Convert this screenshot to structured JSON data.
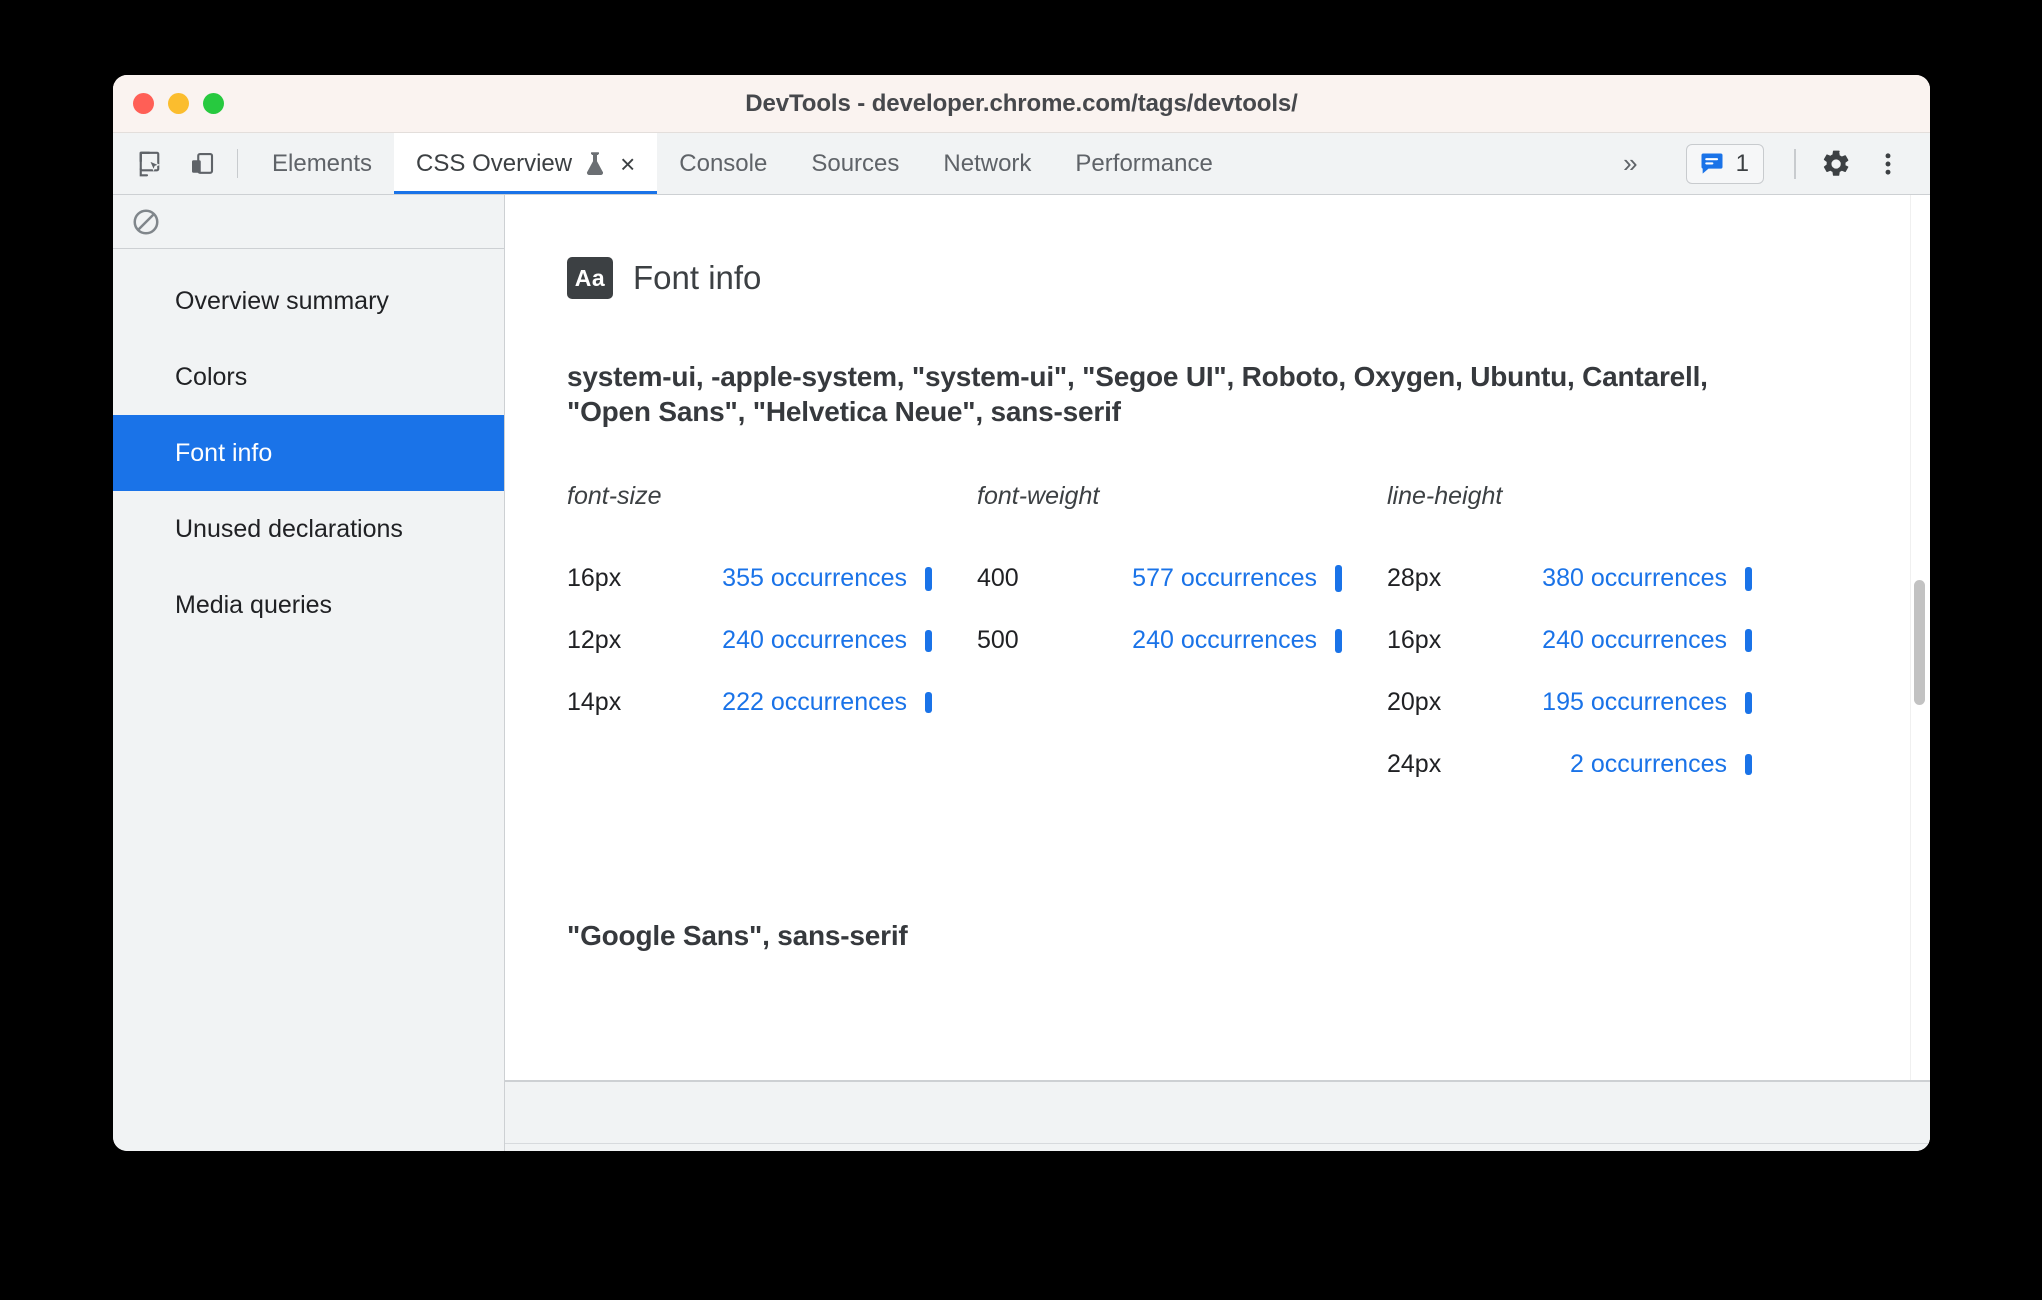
{
  "window": {
    "title": "DevTools - developer.chrome.com/tags/devtools/",
    "traffic_lights": [
      "close",
      "minimize",
      "maximize"
    ]
  },
  "toolbar": {
    "inspect_icon": "inspect-cursor-icon",
    "device_icon": "device-toolbar-icon",
    "tabs": [
      {
        "label": "Elements",
        "active": false
      },
      {
        "label": "CSS Overview",
        "active": true,
        "experimental": true,
        "closable": true,
        "close_label": "×"
      },
      {
        "label": "Console",
        "active": false
      },
      {
        "label": "Sources",
        "active": false
      },
      {
        "label": "Network",
        "active": false
      },
      {
        "label": "Performance",
        "active": false
      }
    ],
    "overflow_label": "»",
    "issues_count": "1",
    "issues_icon": "message-bubble-icon",
    "settings_icon": "gear-icon",
    "more_icon": "kebab-menu-icon"
  },
  "sidebar": {
    "clear_icon": "no-entry-icon",
    "items": [
      {
        "label": "Overview summary",
        "selected": false
      },
      {
        "label": "Colors",
        "selected": false
      },
      {
        "label": "Font info",
        "selected": true
      },
      {
        "label": "Unused declarations",
        "selected": false
      },
      {
        "label": "Media queries",
        "selected": false
      }
    ]
  },
  "main": {
    "badge_text": "Aa",
    "panel_title": "Font info",
    "font_families": [
      {
        "name": "system-ui, -apple-system, \"system-ui\", \"Segoe UI\", Roboto, Oxygen, Ubuntu, Cantarell, \"Open Sans\", \"Helvetica Neue\", sans-serif",
        "columns": [
          {
            "header": "font-size",
            "rows": [
              {
                "value": "16px",
                "occurrences": "355 occurrences",
                "count": 355
              },
              {
                "value": "12px",
                "occurrences": "240 occurrences",
                "count": 240
              },
              {
                "value": "14px",
                "occurrences": "222 occurrences",
                "count": 222
              }
            ]
          },
          {
            "header": "font-weight",
            "rows": [
              {
                "value": "400",
                "occurrences": "577 occurrences",
                "count": 577
              },
              {
                "value": "500",
                "occurrences": "240 occurrences",
                "count": 240
              }
            ]
          },
          {
            "header": "line-height",
            "rows": [
              {
                "value": "28px",
                "occurrences": "380 occurrences",
                "count": 380
              },
              {
                "value": "16px",
                "occurrences": "240 occurrences",
                "count": 240
              },
              {
                "value": "20px",
                "occurrences": "195 occurrences",
                "count": 195
              },
              {
                "value": "24px",
                "occurrences": "2 occurrences",
                "count": 2
              }
            ]
          }
        ]
      },
      {
        "name": "\"Google Sans\", sans-serif",
        "columns": []
      }
    ]
  },
  "colors": {
    "accent_blue": "#1a73e8",
    "toolbar_bg": "#f1f3f4",
    "titlebar_bg": "#faf3f0",
    "text_primary": "#202124",
    "text_secondary": "#5f6368",
    "badge_bg": "#3c4043"
  }
}
